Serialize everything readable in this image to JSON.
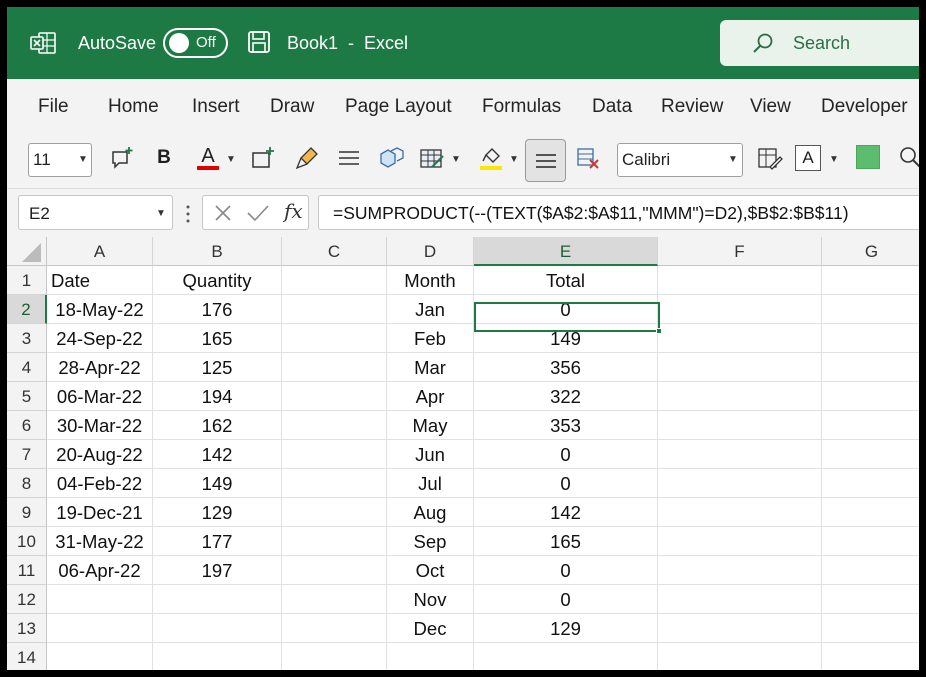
{
  "titlebar": {
    "autosave_label": "AutoSave",
    "autosave_state": "Off",
    "document_title": "Book1  -  Excel",
    "search_placeholder": "Search",
    "brand_color": "#1e7a45"
  },
  "menu": [
    "File",
    "Home",
    "Insert",
    "Draw",
    "Page Layout",
    "Formulas",
    "Data",
    "Review",
    "View",
    "Developer"
  ],
  "ribbon": {
    "font_size": "11",
    "font_name": "Calibri",
    "bold_label": "B",
    "font_color_label": "A",
    "font_color": "#e00000",
    "highlight_color": "#ffe500",
    "fill_color": "#5dbd6e",
    "border_label": "A",
    "icons": [
      "new-comment-icon",
      "bold-icon",
      "font-color-icon",
      "insert-cells-icon",
      "format-painter-icon",
      "align-icon",
      "shape-icon",
      "format-table-icon",
      "highlight-icon",
      "center-align-icon",
      "clear-format-icon",
      "format-cells-icon",
      "border-icon",
      "fill-color-icon",
      "search-tool-icon"
    ]
  },
  "formula_bar": {
    "name_box": "E2",
    "formula": "=SUMPRODUCT(--(TEXT($A$2:$A$11,\"MMM\")=D2),$B$2:$B$11)"
  },
  "sheet": {
    "columns": [
      "A",
      "B",
      "C",
      "D",
      "E",
      "F",
      "G"
    ],
    "rows": [
      "1",
      "2",
      "3",
      "4",
      "5",
      "6",
      "7",
      "8",
      "9",
      "10",
      "11",
      "12",
      "13",
      "14"
    ],
    "active_cell": "E2",
    "data_headers": {
      "date": "Date",
      "quantity": "Quantity",
      "month": "Month",
      "total": "Total"
    },
    "dates": [
      "18-May-22",
      "24-Sep-22",
      "28-Apr-22",
      "06-Mar-22",
      "30-Mar-22",
      "20-Aug-22",
      "04-Feb-22",
      "19-Dec-21",
      "31-May-22",
      "06-Apr-22"
    ],
    "quantities": [
      "176",
      "165",
      "125",
      "194",
      "162",
      "142",
      "149",
      "129",
      "177",
      "197"
    ],
    "months": [
      "Jan",
      "Feb",
      "Mar",
      "Apr",
      "May",
      "Jun",
      "Jul",
      "Aug",
      "Sep",
      "Oct",
      "Nov",
      "Dec"
    ],
    "totals": [
      "0",
      "149",
      "356",
      "322",
      "353",
      "0",
      "0",
      "142",
      "165",
      "0",
      "0",
      "129"
    ]
  }
}
